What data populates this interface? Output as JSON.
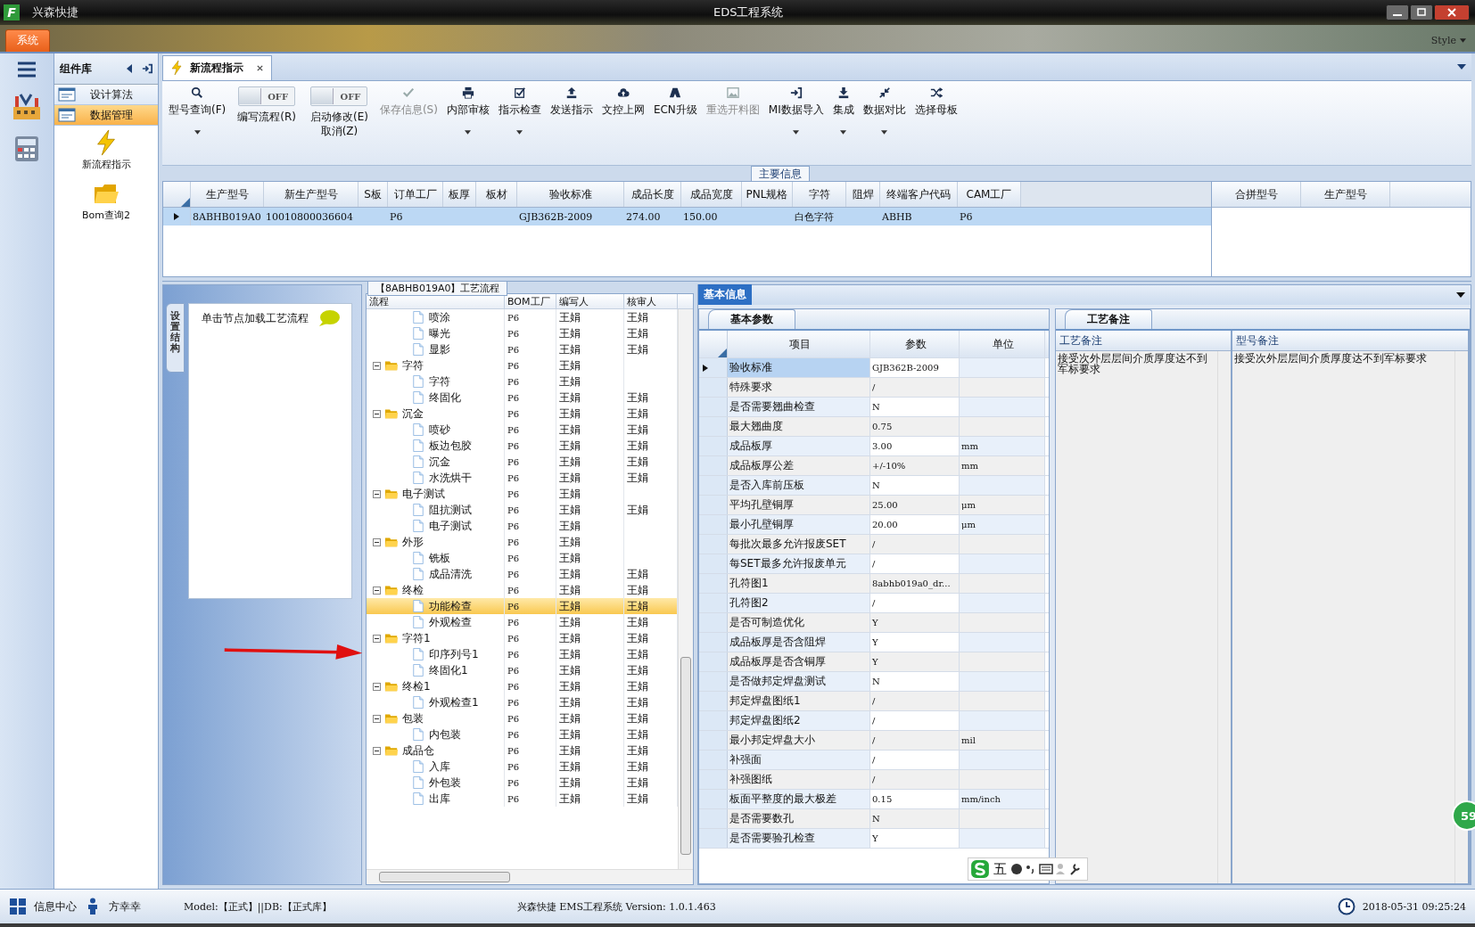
{
  "window": {
    "logo": "F",
    "app_name": "兴森快捷",
    "title": "EDS工程系统"
  },
  "menu": {
    "items": [
      {
        "label": "系统",
        "selected": true
      }
    ],
    "style_label": "Style"
  },
  "nav": {
    "header": "组件库",
    "items": [
      {
        "label": "设计算法",
        "selected": false
      },
      {
        "label": "数据管理",
        "selected": true
      }
    ],
    "tools": [
      {
        "label": "新流程指示"
      },
      {
        "label": "Bom查询2"
      }
    ]
  },
  "tabs": [
    {
      "label": "新流程指示",
      "selected": true,
      "closable": true
    }
  ],
  "toolbar": [
    {
      "kind": "button",
      "label": "型号查询(F)",
      "disabled": false,
      "dropdown": true
    },
    {
      "kind": "toggle",
      "label": "编写流程(R)",
      "state_text": "OFF",
      "on": false
    },
    {
      "kind": "toggle",
      "label": "启动修改(E)\n取消(Z)",
      "state_text": "OFF",
      "on": false
    },
    {
      "kind": "button",
      "label": "保存信息(S)",
      "disabled": true,
      "dropdown": false
    },
    {
      "kind": "button",
      "label": "内部审核",
      "disabled": false,
      "dropdown": true
    },
    {
      "kind": "button",
      "label": "指示检查",
      "disabled": false,
      "dropdown": true
    },
    {
      "kind": "button",
      "label": "发送指示",
      "disabled": false,
      "dropdown": false
    },
    {
      "kind": "button",
      "label": "文控上网",
      "disabled": false,
      "dropdown": false
    },
    {
      "kind": "button",
      "label": "ECN升级",
      "disabled": false,
      "dropdown": false
    },
    {
      "kind": "button",
      "label": "重选开料图",
      "disabled": true,
      "dropdown": false
    },
    {
      "kind": "button",
      "label": "MI数据导入",
      "disabled": false,
      "dropdown": true
    },
    {
      "kind": "button",
      "label": "集成",
      "disabled": false,
      "dropdown": true
    },
    {
      "kind": "button",
      "label": "数据对比",
      "disabled": false,
      "dropdown": true
    },
    {
      "kind": "button",
      "label": "选择母板",
      "disabled": false,
      "dropdown": false
    }
  ],
  "main_info": {
    "title": "主要信息",
    "columns": [
      "生产型号",
      "新生产型号",
      "S板",
      "订单工厂",
      "板厚",
      "板材",
      "验收标准",
      "成品长度",
      "成品宽度",
      "PNL规格",
      "字符",
      "阻焊",
      "终端客户代码",
      "CAM工厂"
    ],
    "rows": [
      {
        "selected": true,
        "cells": [
          "8ABHB019A0",
          "10010800036604",
          "",
          "P6",
          "",
          "",
          "GJB362B-2009",
          "274.00",
          "150.00",
          "",
          "白色字符",
          "",
          "ABHB",
          "P6"
        ]
      }
    ],
    "side_columns": [
      "合拼型号",
      "生产型号"
    ]
  },
  "structure": {
    "side_tab": "设置结构",
    "hint": "单击节点加载工艺流程"
  },
  "flow": {
    "title": "【8ABHB019A0】工艺流程",
    "columns": [
      "流程",
      "BOM工厂",
      "编写人",
      "核审人"
    ],
    "nodes": [
      {
        "kind": "leaf",
        "name": "喷涂",
        "factory": "P6",
        "writer": "王娟",
        "reviewer": "王娟",
        "selected": false
      },
      {
        "kind": "leaf",
        "name": "曝光",
        "factory": "P6",
        "writer": "王娟",
        "reviewer": "王娟",
        "selected": false
      },
      {
        "kind": "leaf",
        "name": "显影",
        "factory": "P6",
        "writer": "王娟",
        "reviewer": "王娟",
        "selected": false
      },
      {
        "kind": "folder",
        "name": "字符",
        "factory": "P6",
        "writer": "王娟",
        "selected": false,
        "expanded": true,
        "children": [
          {
            "kind": "leaf",
            "name": "字符",
            "factory": "P6",
            "writer": "王娟",
            "selected": false
          },
          {
            "kind": "leaf",
            "name": "终固化",
            "factory": "P6",
            "writer": "王娟",
            "reviewer": "王娟",
            "selected": false
          }
        ]
      },
      {
        "kind": "folder",
        "name": "沉金",
        "factory": "P6",
        "writer": "王娟",
        "reviewer": "王娟",
        "selected": false,
        "expanded": true,
        "children": [
          {
            "kind": "leaf",
            "name": "喷砂",
            "factory": "P6",
            "writer": "王娟",
            "reviewer": "王娟",
            "selected": false
          },
          {
            "kind": "leaf",
            "name": "板边包胶",
            "factory": "P6",
            "writer": "王娟",
            "reviewer": "王娟",
            "selected": false
          },
          {
            "kind": "leaf",
            "name": "沉金",
            "factory": "P6",
            "writer": "王娟",
            "reviewer": "王娟",
            "selected": false
          },
          {
            "kind": "leaf",
            "name": "水洗烘干",
            "factory": "P6",
            "writer": "王娟",
            "reviewer": "王娟",
            "selected": false
          }
        ]
      },
      {
        "kind": "folder",
        "name": "电子测试",
        "factory": "P6",
        "writer": "王娟",
        "selected": false,
        "expanded": true,
        "children": [
          {
            "kind": "leaf",
            "name": "阻抗测试",
            "factory": "P6",
            "writer": "王娟",
            "reviewer": "王娟",
            "selected": false
          },
          {
            "kind": "leaf",
            "name": "电子测试",
            "factory": "P6",
            "writer": "王娟",
            "selected": false
          }
        ]
      },
      {
        "kind": "folder",
        "name": "外形",
        "factory": "P6",
        "writer": "王娟",
        "selected": false,
        "expanded": true,
        "children": [
          {
            "kind": "leaf",
            "name": "铣板",
            "factory": "P6",
            "writer": "王娟",
            "selected": false
          },
          {
            "kind": "leaf",
            "name": "成品清洗",
            "factory": "P6",
            "writer": "王娟",
            "reviewer": "王娟",
            "selected": false
          }
        ]
      },
      {
        "kind": "folder",
        "name": "终检",
        "factory": "P6",
        "writer": "王娟",
        "reviewer": "王娟",
        "selected": false,
        "expanded": true,
        "children": [
          {
            "kind": "leaf",
            "name": "功能检查",
            "factory": "P6",
            "writer": "王娟",
            "reviewer": "王娟",
            "selected": true
          },
          {
            "kind": "leaf",
            "name": "外观检查",
            "factory": "P6",
            "writer": "王娟",
            "reviewer": "王娟",
            "selected": false
          }
        ]
      },
      {
        "kind": "folder",
        "name": "字符1",
        "factory": "P6",
        "writer": "王娟",
        "reviewer": "王娟",
        "selected": false,
        "expanded": true,
        "children": [
          {
            "kind": "leaf",
            "name": "印序列号1",
            "factory": "P6",
            "writer": "王娟",
            "reviewer": "王娟",
            "selected": false
          },
          {
            "kind": "leaf",
            "name": "终固化1",
            "factory": "P6",
            "writer": "王娟",
            "reviewer": "王娟",
            "selected": false
          }
        ]
      },
      {
        "kind": "folder",
        "name": "终检1",
        "factory": "P6",
        "writer": "王娟",
        "reviewer": "王娟",
        "selected": false,
        "expanded": true,
        "children": [
          {
            "kind": "leaf",
            "name": "外观检查1",
            "factory": "P6",
            "writer": "王娟",
            "reviewer": "王娟",
            "selected": false
          }
        ]
      },
      {
        "kind": "folder",
        "name": "包装",
        "factory": "P6",
        "writer": "王娟",
        "reviewer": "王娟",
        "selected": false,
        "expanded": true,
        "children": [
          {
            "kind": "leaf",
            "name": "内包装",
            "factory": "P6",
            "writer": "王娟",
            "reviewer": "王娟",
            "selected": false
          }
        ]
      },
      {
        "kind": "folder",
        "name": "成品仓",
        "factory": "P6",
        "writer": "王娟",
        "reviewer": "王娟",
        "selected": false,
        "expanded": true,
        "children": [
          {
            "kind": "leaf",
            "name": "入库",
            "factory": "P6",
            "writer": "王娟",
            "reviewer": "王娟",
            "selected": false
          },
          {
            "kind": "leaf",
            "name": "外包装",
            "factory": "P6",
            "writer": "王娟",
            "reviewer": "王娟",
            "selected": false
          },
          {
            "kind": "leaf",
            "name": "出库",
            "factory": "P6",
            "writer": "王娟",
            "reviewer": "王娟",
            "selected": false
          }
        ]
      }
    ]
  },
  "basic_info": {
    "title": "基本信息",
    "params_tab": "基本参数",
    "columns": [
      "项目",
      "参数",
      "单位"
    ],
    "rows": [
      {
        "item": "验收标准",
        "value": "GJB362B-2009",
        "unit": "",
        "selected": true
      },
      {
        "item": "特殊要求",
        "value": "/",
        "unit": "",
        "selected": false
      },
      {
        "item": "是否需要翘曲检查",
        "value": "N",
        "unit": "",
        "selected": false
      },
      {
        "item": "最大翘曲度",
        "value": "0.75",
        "unit": "",
        "selected": false
      },
      {
        "item": "成品板厚",
        "value": "3.00",
        "unit": "mm",
        "selected": false
      },
      {
        "item": "成品板厚公差",
        "value": "+/-10%",
        "unit": "mm",
        "selected": false
      },
      {
        "item": "是否入库前压板",
        "value": "N",
        "unit": "",
        "selected": false
      },
      {
        "item": "平均孔壁铜厚",
        "value": "25.00",
        "unit": "μm",
        "selected": false
      },
      {
        "item": "最小孔壁铜厚",
        "value": "20.00",
        "unit": "μm",
        "selected": false
      },
      {
        "item": "每批次最多允许报废SET",
        "value": "/",
        "unit": "",
        "selected": false
      },
      {
        "item": "每SET最多允许报废单元",
        "value": "/",
        "unit": "",
        "selected": false
      },
      {
        "item": "孔符图1",
        "value": "8abhb019a0_dr...",
        "unit": "",
        "selected": false
      },
      {
        "item": "孔符图2",
        "value": "/",
        "unit": "",
        "selected": false
      },
      {
        "item": "是否可制造优化",
        "value": "Y",
        "unit": "",
        "selected": false
      },
      {
        "item": "成品板厚是否含阻焊",
        "value": "Y",
        "unit": "",
        "selected": false
      },
      {
        "item": "成品板厚是否含铜厚",
        "value": "Y",
        "unit": "",
        "selected": false
      },
      {
        "item": "是否做邦定焊盘测试",
        "value": "N",
        "unit": "",
        "selected": false
      },
      {
        "item": "邦定焊盘图纸1",
        "value": "/",
        "unit": "",
        "selected": false
      },
      {
        "item": "邦定焊盘图纸2",
        "value": "/",
        "unit": "",
        "selected": false
      },
      {
        "item": "最小邦定焊盘大小",
        "value": "/",
        "unit": "mil",
        "selected": false
      },
      {
        "item": "补强面",
        "value": "/",
        "unit": "",
        "selected": false
      },
      {
        "item": "补强图纸",
        "value": "/",
        "unit": "",
        "selected": false
      },
      {
        "item": "板面平整度的最大极差",
        "value": "0.15",
        "unit": "mm/inch",
        "selected": false
      },
      {
        "item": "是否需要数孔",
        "value": "N",
        "unit": "",
        "selected": false
      },
      {
        "item": "是否需要验孔检查",
        "value": "Y",
        "unit": "",
        "selected": false
      }
    ]
  },
  "notes": {
    "tab": "工艺备注",
    "columns": [
      {
        "title": "工艺备注",
        "text": "接受次外层层间介质厚度达不到军标要求"
      },
      {
        "title": "型号备注",
        "text": "接受次外层层间介质厚度达不到军标要求"
      }
    ]
  },
  "ime": {
    "mode": "五"
  },
  "badge": "59",
  "status_bar": {
    "info_center": "信息中心",
    "user": "方幸幸",
    "model": "Model:【正式】||DB:【正式库】",
    "version": "兴森快捷 EMS工程系统 Version: 1.0.1.463",
    "datetime": "2018-05-31 09:25:24"
  }
}
